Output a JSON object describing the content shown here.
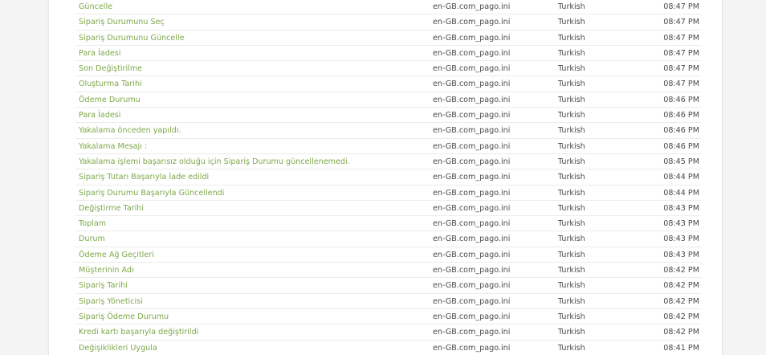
{
  "colors": {
    "link": "#7da84a",
    "text": "#4a4a4a",
    "row_border": "#ececec",
    "background": "#f4f4f4",
    "card": "#ffffff"
  },
  "rows": [
    {
      "key": "Güncelle",
      "file": "en-GB.com_pago.ini",
      "language": "Turkish",
      "time": "08:47 PM"
    },
    {
      "key": "Sipariş Durumunu Seç",
      "file": "en-GB.com_pago.ini",
      "language": "Turkish",
      "time": "08:47 PM"
    },
    {
      "key": "Sipariş Durumunu Güncelle",
      "file": "en-GB.com_pago.ini",
      "language": "Turkish",
      "time": "08:47 PM"
    },
    {
      "key": "Para İadesi",
      "file": "en-GB.com_pago.ini",
      "language": "Turkish",
      "time": "08:47 PM"
    },
    {
      "key": "Son Değiştirilme",
      "file": "en-GB.com_pago.ini",
      "language": "Turkish",
      "time": "08:47 PM"
    },
    {
      "key": "Oluşturma Tarihi",
      "file": "en-GB.com_pago.ini",
      "language": "Turkish",
      "time": "08:47 PM"
    },
    {
      "key": "Ödeme Durumu",
      "file": "en-GB.com_pago.ini",
      "language": "Turkish",
      "time": "08:46 PM"
    },
    {
      "key": "Para İadesi",
      "file": "en-GB.com_pago.ini",
      "language": "Turkish",
      "time": "08:46 PM"
    },
    {
      "key": "Yakalama önceden yapıldı.",
      "file": "en-GB.com_pago.ini",
      "language": "Turkish",
      "time": "08:46 PM"
    },
    {
      "key": "Yakalama Mesajı :",
      "file": "en-GB.com_pago.ini",
      "language": "Turkish",
      "time": "08:46 PM"
    },
    {
      "key": "Yakalama işlemi başarısız olduğu için Sipariş Durumu güncellenemedi.",
      "file": "en-GB.com_pago.ini",
      "language": "Turkish",
      "time": "08:45 PM"
    },
    {
      "key": "Sipariş Tutarı Başarıyla İade edildi",
      "file": "en-GB.com_pago.ini",
      "language": "Turkish",
      "time": "08:44 PM"
    },
    {
      "key": "Sipariş Durumu Başarıyla Güncellendi",
      "file": "en-GB.com_pago.ini",
      "language": "Turkish",
      "time": "08:44 PM"
    },
    {
      "key": "Değiştirme Tarihi",
      "file": "en-GB.com_pago.ini",
      "language": "Turkish",
      "time": "08:43 PM"
    },
    {
      "key": "Toplam",
      "file": "en-GB.com_pago.ini",
      "language": "Turkish",
      "time": "08:43 PM"
    },
    {
      "key": "Durum",
      "file": "en-GB.com_pago.ini",
      "language": "Turkish",
      "time": "08:43 PM"
    },
    {
      "key": "Ödeme Ağ Geçitleri",
      "file": "en-GB.com_pago.ini",
      "language": "Turkish",
      "time": "08:43 PM"
    },
    {
      "key": "Müşterinin Adı",
      "file": "en-GB.com_pago.ini",
      "language": "Turkish",
      "time": "08:42 PM"
    },
    {
      "key": "Sipariş Tarihi",
      "file": "en-GB.com_pago.ini",
      "language": "Turkish",
      "time": "08:42 PM"
    },
    {
      "key": "Sipariş Yöneticisi",
      "file": "en-GB.com_pago.ini",
      "language": "Turkish",
      "time": "08:42 PM"
    },
    {
      "key": "Sipariş Ödeme Durumu",
      "file": "en-GB.com_pago.ini",
      "language": "Turkish",
      "time": "08:42 PM"
    },
    {
      "key": "Kredi kartı başarıyla değiştirildi",
      "file": "en-GB.com_pago.ini",
      "language": "Turkish",
      "time": "08:42 PM"
    },
    {
      "key": "Değişiklikleri Uygula",
      "file": "en-GB.com_pago.ini",
      "language": "Turkish",
      "time": "08:41 PM"
    }
  ]
}
